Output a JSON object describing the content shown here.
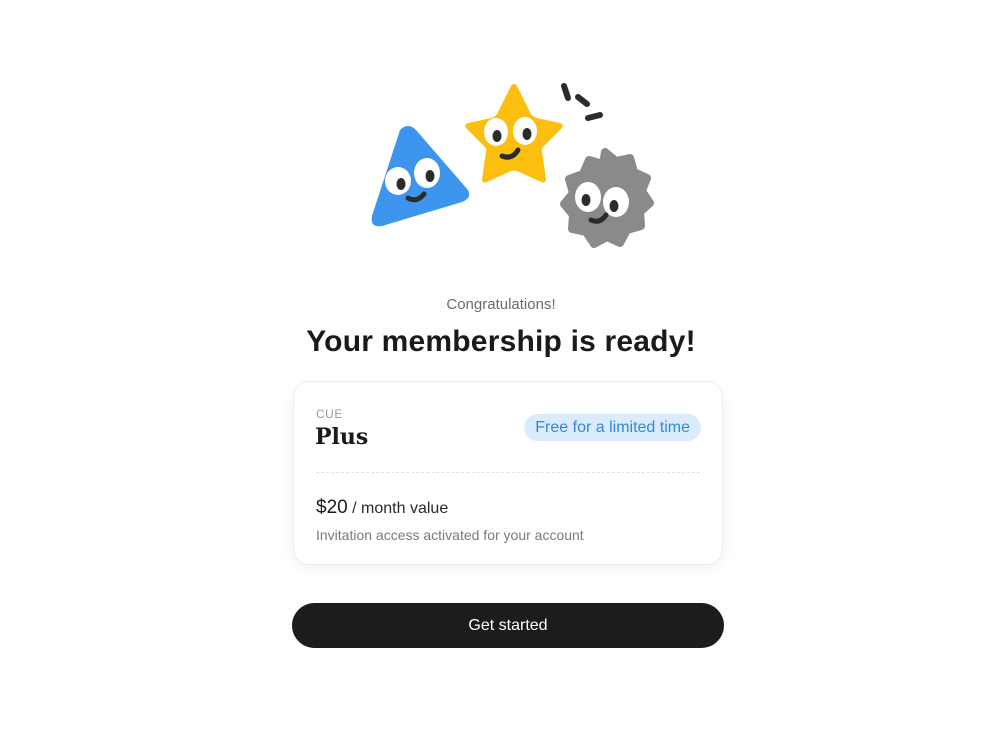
{
  "hero": {
    "illustration": "three-smiling-shapes",
    "shapes": [
      "triangle-character",
      "star-character",
      "gear-character"
    ],
    "colors": {
      "triangle": "#3d95ee",
      "star": "#fdbf0f",
      "gear": "#8a8a8a",
      "face": "#2b2b2b"
    }
  },
  "header": {
    "subtitle": "Congratulations!",
    "title": "Your membership is ready!"
  },
  "plan_card": {
    "brand": "CUE",
    "plan_name": "Plus",
    "badge": "Free for a limited time",
    "price_amount": "$20",
    "price_suffix": "/ month value",
    "note": "Invitation access activated for your account"
  },
  "actions": {
    "primary_label": "Get started"
  },
  "theme": {
    "accent_badge_bg": "#dcebfb",
    "accent_badge_text": "#2f88e0",
    "button_bg": "#1c1c1c"
  }
}
